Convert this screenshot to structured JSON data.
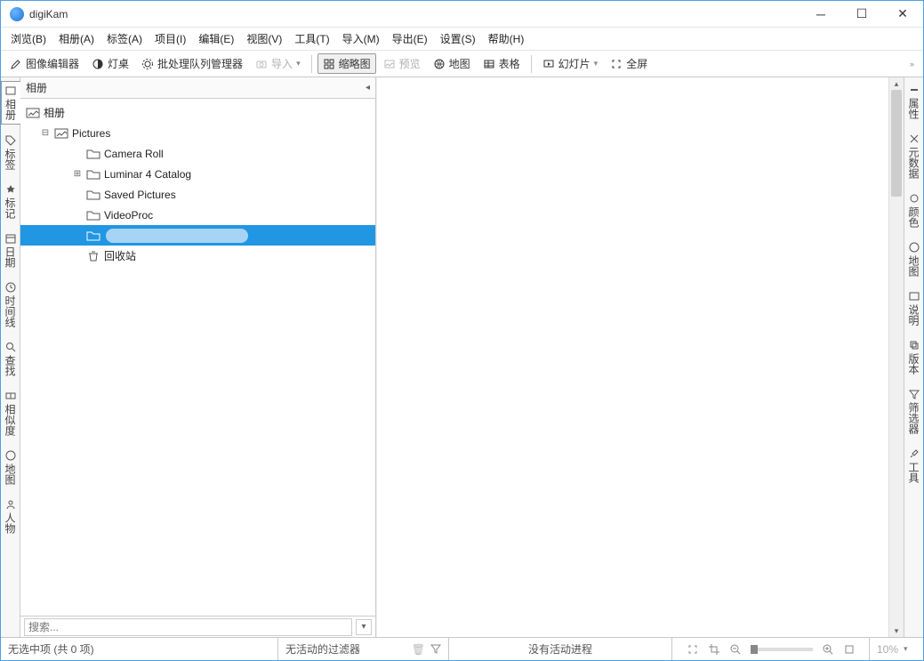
{
  "titlebar": {
    "title": "digiKam"
  },
  "menu": {
    "browse": "浏览(B)",
    "album": "相册(A)",
    "tags": "标签(A)",
    "project": "项目(I)",
    "edit": "编辑(E)",
    "view": "视图(V)",
    "tools": "工具(T)",
    "import": "导入(M)",
    "export": "导出(E)",
    "settings": "设置(S)",
    "help": "帮助(H)"
  },
  "toolbar": {
    "image_editor": "图像编辑器",
    "light_table": "灯桌",
    "batch_queue": "批处理队列管理器",
    "import_btn": "导入",
    "thumbnails": "缩略图",
    "preview": "预览",
    "map": "地图",
    "table": "表格",
    "slideshow": "幻灯片",
    "fullscreen": "全屏"
  },
  "left_tabs": {
    "album": "相册",
    "tags": "标签",
    "marks": "标记",
    "date": "日期",
    "timeline": "时间线",
    "search": "查找",
    "similarity": "相似度",
    "map": "地图",
    "people": "人物"
  },
  "right_tabs": {
    "properties": "属性",
    "metadata": "元数据",
    "color": "颜色",
    "map": "地图",
    "caption": "说明",
    "version": "版本",
    "filter": "筛选器",
    "tools": "工具"
  },
  "panel": {
    "header": "相册"
  },
  "tree": {
    "root": "相册",
    "pictures": "Pictures",
    "camera_roll": "Camera Roll",
    "luminar": "Luminar 4 Catalog",
    "saved_pictures": "Saved Pictures",
    "videoproc": "VideoProc",
    "recycle": "回收站"
  },
  "search": {
    "placeholder": "搜索..."
  },
  "status": {
    "selection": "无选中项 (共 0 项)",
    "filter": "无活动的过滤器",
    "progress": "没有活动进程",
    "zoom": "10%"
  }
}
